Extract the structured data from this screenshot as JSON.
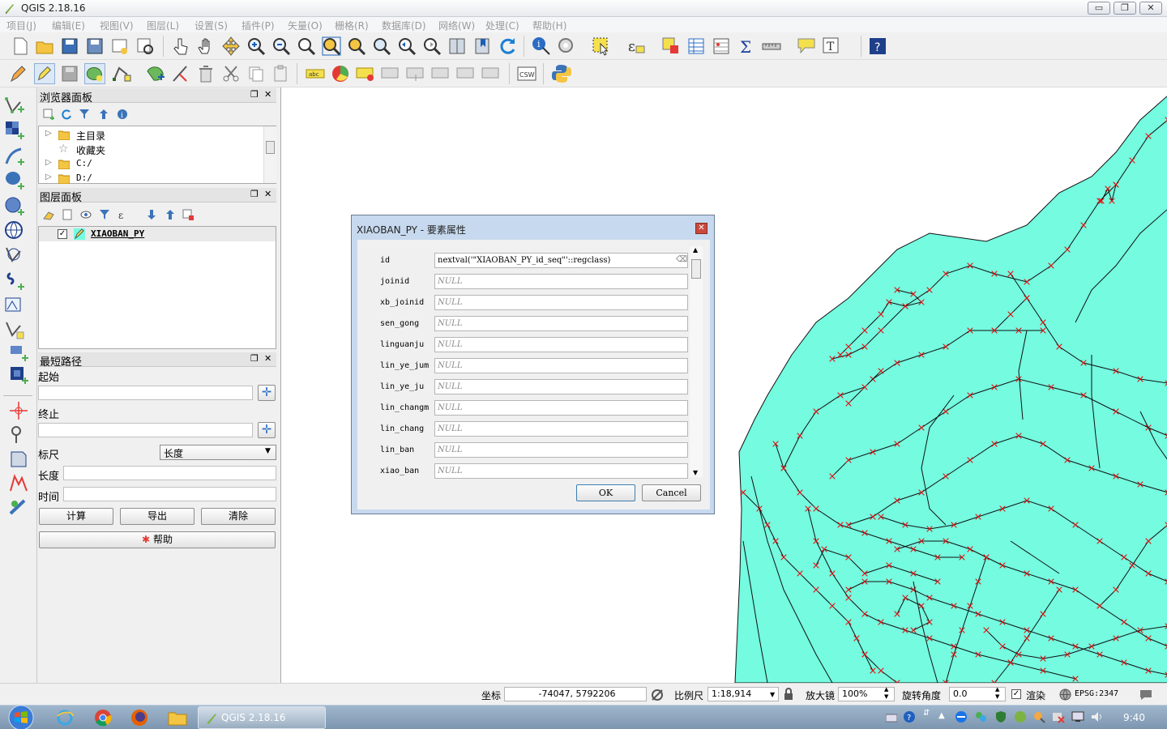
{
  "window": {
    "title": "QGIS 2.18.16",
    "minimize_label": "▭",
    "restore_label": "❐",
    "close_label": "✕"
  },
  "menu": [
    "项目(J)",
    "编辑(E)",
    "视图(V)",
    "图层(L)",
    "设置(S)",
    "插件(P)",
    "矢量(O)",
    "栅格(R)",
    "数据库(D)",
    "网络(W)",
    "处理(C)",
    "帮助(H)"
  ],
  "toolbar2": {
    "csw_label": "CSW",
    "abc_label": "abc"
  },
  "browser_panel": {
    "title": "浏览器面板",
    "items": [
      {
        "label": "主目录"
      },
      {
        "label": "收藏夹"
      },
      {
        "label": "C:/"
      },
      {
        "label": "D:/"
      }
    ]
  },
  "layers_panel": {
    "title": "图层面板",
    "layers": [
      {
        "name": "XIAOBAN_PY"
      }
    ]
  },
  "route_panel": {
    "title": "最短路径",
    "start_label": "起始",
    "end_label": "终止",
    "criterion_label": "标尺",
    "criterion_value": "长度",
    "length_label": "长度",
    "time_label": "时间",
    "calc_label": "计算",
    "export_label": "导出",
    "clear_label": "清除",
    "help_label": "帮助"
  },
  "dialog": {
    "title": "XIAOBAN_PY - 要素属性",
    "fields": [
      {
        "name": "id",
        "value": "nextval('\"XIAOBAN_PY_id_seq\"'::regclass)"
      },
      {
        "name": "joinid",
        "value": "NULL"
      },
      {
        "name": "xb_joinid",
        "value": "NULL"
      },
      {
        "name": "sen_gong",
        "value": "NULL"
      },
      {
        "name": "linguanju",
        "value": "NULL"
      },
      {
        "name": "lin_ye_jum",
        "value": "NULL"
      },
      {
        "name": "lin_ye_ju",
        "value": "NULL"
      },
      {
        "name": "lin_changm",
        "value": "NULL"
      },
      {
        "name": "lin_chang",
        "value": "NULL"
      },
      {
        "name": "lin_ban",
        "value": "NULL"
      },
      {
        "name": "xiao_ban",
        "value": "NULL"
      }
    ],
    "ok_label": "OK",
    "cancel_label": "Cancel"
  },
  "statusbar": {
    "coord_label": "坐标",
    "coord_value": "-74047, 5792206",
    "scale_label": "比例尺",
    "scale_value": "1:18,914",
    "magnifier_label": "放大镜",
    "magnifier_value": "100%",
    "rotation_label": "旋转角度",
    "rotation_value": "0.0",
    "render_label": "渲染",
    "crs_label": "EPSG:2347"
  },
  "taskbar": {
    "qgis_label": "QGIS 2.18.16",
    "clock": "9:40"
  },
  "colors": {
    "polygon_fill": "#74fbe0",
    "vertex_marker": "#e01010",
    "title_close": "#c84a3d"
  }
}
